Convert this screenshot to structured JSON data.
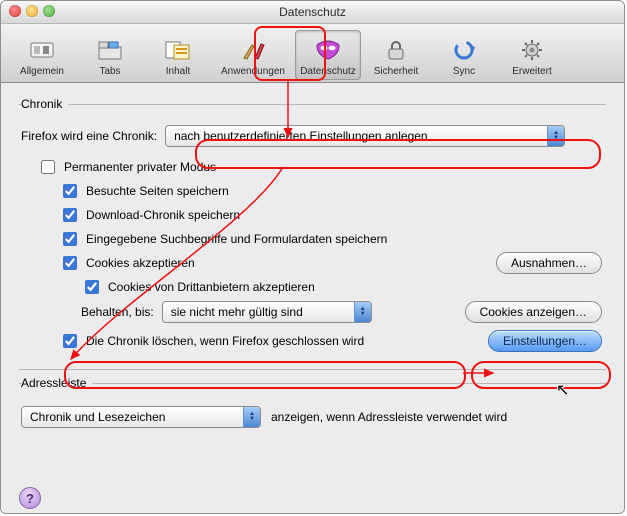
{
  "window": {
    "title": "Datenschutz"
  },
  "toolbar": {
    "items": [
      {
        "label": "Allgemein"
      },
      {
        "label": "Tabs"
      },
      {
        "label": "Inhalt"
      },
      {
        "label": "Anwendungen"
      },
      {
        "label": "Datenschutz"
      },
      {
        "label": "Sicherheit"
      },
      {
        "label": "Sync"
      },
      {
        "label": "Erweitert"
      }
    ],
    "selected_index": 4
  },
  "chronik": {
    "legend": "Chronik",
    "mode_label": "Firefox wird eine Chronik:",
    "mode_value": "nach benutzerdefinierten Einstellungen anlegen",
    "private_mode": "Permanenter privater Modus",
    "remember_pages": "Besuchte Seiten speichern",
    "remember_downloads": "Download-Chronik speichern",
    "remember_forms": "Eingegebene Suchbegriffe und Formulardaten speichern",
    "accept_cookies": "Cookies akzeptieren",
    "third_party": "Cookies von Drittanbietern akzeptieren",
    "keep_until_label": "Behalten, bis:",
    "keep_until_value": "sie nicht mehr gültig sind",
    "clear_on_close": "Die Chronik löschen, wenn Firefox geschlossen wird",
    "btn_exceptions": "Ausnahmen…",
    "btn_show_cookies": "Cookies anzeigen…",
    "btn_settings": "Einstellungen…"
  },
  "addressbar": {
    "legend": "Adressleiste",
    "select_value": "Chronik und Lesezeichen",
    "suffix": "anzeigen, wenn Adressleiste verwendet wird"
  },
  "help_glyph": "?"
}
